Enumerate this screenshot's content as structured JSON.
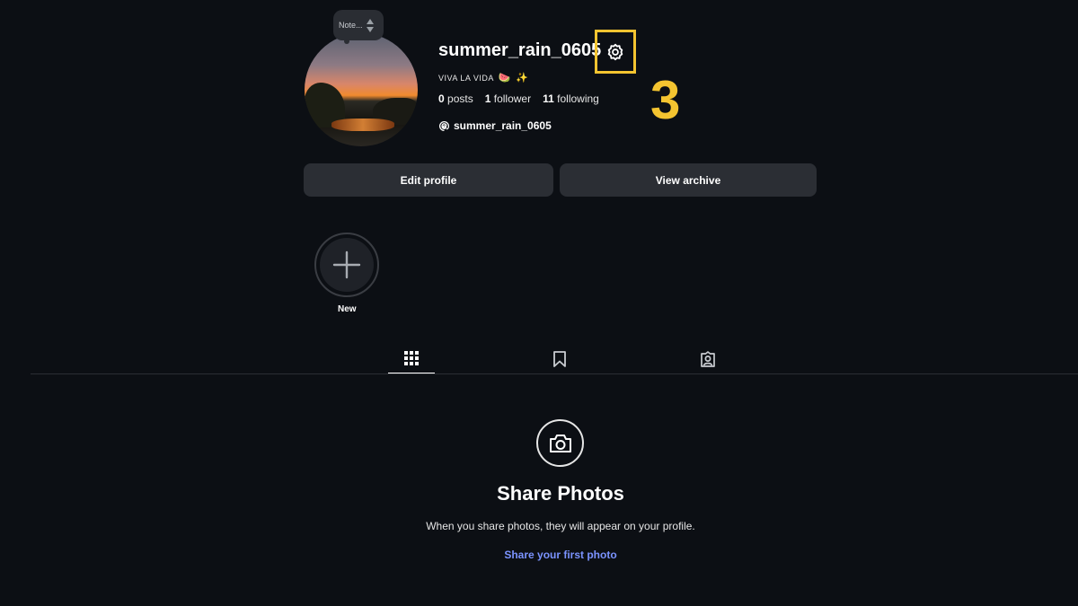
{
  "profile": {
    "username": "summer_rain_0605",
    "bio_text": "VIVA LA VIDA",
    "bio_emoji_1": "🍉",
    "bio_emoji_2": "✨",
    "threads_handle": "summer_rain_0605",
    "note_placeholder": "Note...",
    "stats": {
      "posts_count": "0",
      "posts_label": "posts",
      "followers_count": "1",
      "followers_label": "follower",
      "following_count": "11",
      "following_label": "following"
    }
  },
  "buttons": {
    "edit_profile": "Edit profile",
    "view_archive": "View archive"
  },
  "highlights": {
    "new_label": "New"
  },
  "annotation": {
    "step_number": "3",
    "highlight_color": "#f4c430"
  },
  "tabs": [
    {
      "icon": "grid-icon",
      "active": true
    },
    {
      "icon": "bookmark-icon",
      "active": false
    },
    {
      "icon": "tagged-icon",
      "active": false
    }
  ],
  "empty_state": {
    "icon": "camera-icon",
    "title": "Share Photos",
    "description": "When you share photos, they will appear on your profile.",
    "link": "Share your first photo"
  },
  "colors": {
    "background": "#0c0f14",
    "button": "#2b2e34",
    "link": "#7b93ff"
  }
}
